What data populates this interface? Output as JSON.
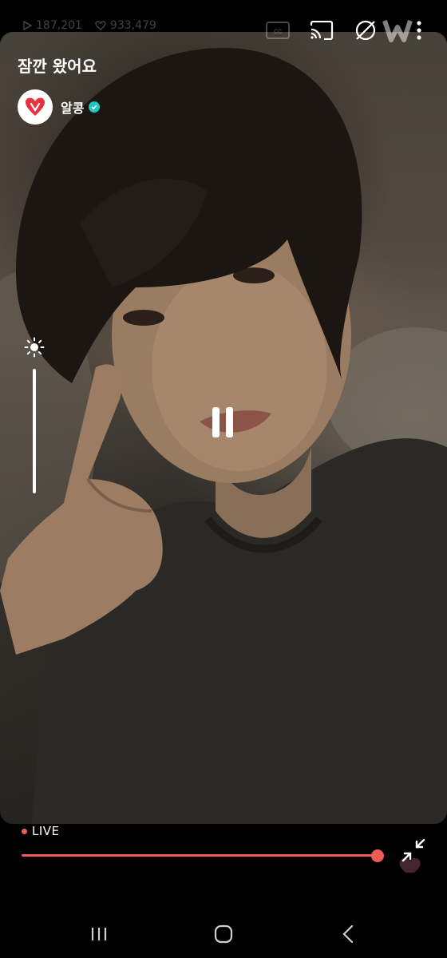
{
  "video": {
    "title": "잠깐 왔어요",
    "views": "187,201",
    "likes": "933,479"
  },
  "channel": {
    "name": "알콩",
    "avatar_icon": "heart-logo-icon",
    "verified_icon": "verified-check-icon"
  },
  "top_icons": [
    "cc-icon",
    "cast-icon",
    "rotate-off-icon",
    "weverse-watermark-icon",
    "more-vert-icon"
  ],
  "player": {
    "live_label": "LIVE",
    "progress": 1.0,
    "brightness_icon": "brightness-icon",
    "pause_icon": "pause-icon",
    "minimize_icon": "minimize-icon"
  },
  "navbar": [
    "recent-apps-icon",
    "home-icon",
    "back-icon"
  ],
  "colors": {
    "accent": "#ef5a5a",
    "verified": "#1fc7c0",
    "avatar_heart": "#e8333f"
  }
}
